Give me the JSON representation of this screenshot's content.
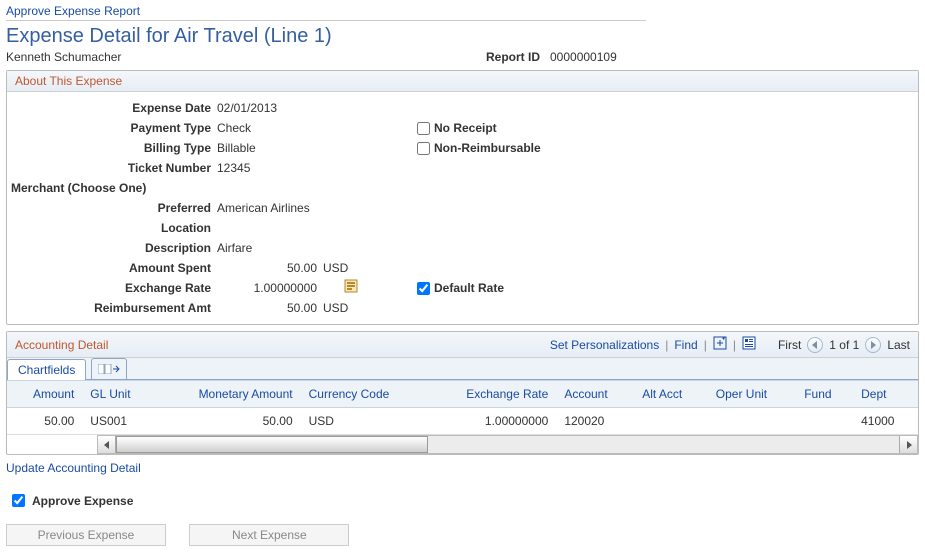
{
  "breadcrumb": "Approve Expense Report",
  "page_title": "Expense Detail for Air Travel (Line 1)",
  "owner_name": "Kenneth Schumacher",
  "report_id_label": "Report ID",
  "report_id": "0000000109",
  "about_section_title": "About This Expense",
  "labels": {
    "expense_date": "Expense Date",
    "payment_type": "Payment Type",
    "billing_type": "Billing Type",
    "ticket_number": "Ticket Number",
    "merchant_header": "Merchant (Choose One)",
    "preferred": "Preferred",
    "location": "Location",
    "description": "Description",
    "amount_spent": "Amount Spent",
    "exchange_rate": "Exchange Rate",
    "reimbursement_amt": "Reimbursement Amt",
    "no_receipt": "No Receipt",
    "non_reimbursable": "Non-Reimbursable",
    "default_rate": "Default Rate"
  },
  "values": {
    "expense_date": "02/01/2013",
    "payment_type": "Check",
    "billing_type": "Billable",
    "ticket_number": "12345",
    "preferred": "American Airlines",
    "location": "",
    "description": "Airfare",
    "amount_spent": "50.00",
    "amount_spent_ccy": "USD",
    "exchange_rate": "1.00000000",
    "reimbursement_amt": "50.00",
    "reimbursement_ccy": "USD"
  },
  "flags": {
    "no_receipt": false,
    "non_reimbursable": false,
    "default_rate": true,
    "approve_expense": true
  },
  "accounting_section_title": "Accounting Detail",
  "grid_toolbar": {
    "set_personalizations": "Set Personalizations",
    "find": "Find",
    "first": "First",
    "position": "1 of 1",
    "last": "Last"
  },
  "tabs": {
    "chartfields": "Chartfields"
  },
  "grid": {
    "columns": [
      "Amount",
      "GL Unit",
      "Monetary Amount",
      "Currency Code",
      "Exchange Rate",
      "Account",
      "Alt Acct",
      "Oper Unit",
      "Fund",
      "Dept"
    ],
    "rows": [
      {
        "amount": "50.00",
        "gl_unit": "US001",
        "monetary_amount": "50.00",
        "currency_code": "USD",
        "exchange_rate": "1.00000000",
        "account": "120020",
        "alt_acct": "",
        "oper_unit": "",
        "fund": "",
        "dept": "41000"
      }
    ]
  },
  "links": {
    "update_accounting_detail": "Update Accounting Detail"
  },
  "approve_expense_label": "Approve Expense",
  "buttons": {
    "previous": "Previous Expense",
    "next": "Next Expense"
  }
}
